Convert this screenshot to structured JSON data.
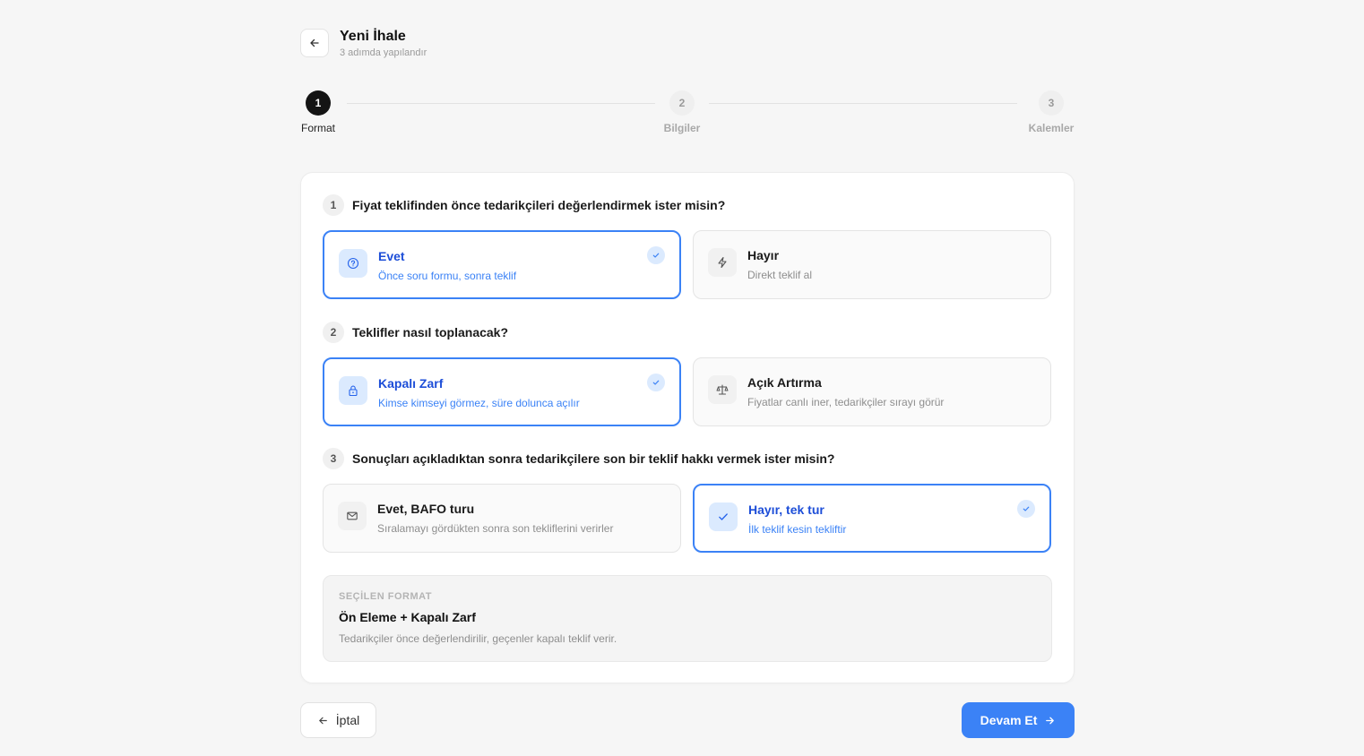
{
  "header": {
    "title": "Yeni İhale",
    "subtitle": "3 adımda yapılandır"
  },
  "steps": [
    {
      "number": "1",
      "label": "Format",
      "active": true
    },
    {
      "number": "2",
      "label": "Bilgiler",
      "active": false
    },
    {
      "number": "3",
      "label": "Kalemler",
      "active": false
    }
  ],
  "questions": [
    {
      "number": "1",
      "text": "Fiyat teklifinden önce tedarikçileri değerlendirmek ister misin?",
      "options": [
        {
          "title": "Evet",
          "desc": "Önce soru formu, sonra teklif",
          "icon": "question-circle-icon",
          "selected": true
        },
        {
          "title": "Hayır",
          "desc": "Direkt teklif al",
          "icon": "lightning-icon",
          "selected": false
        }
      ]
    },
    {
      "number": "2",
      "text": "Teklifler nasıl toplanacak?",
      "options": [
        {
          "title": "Kapalı Zarf",
          "desc": "Kimse kimseyi görmez, süre dolunca açılır",
          "icon": "lock-icon",
          "selected": true
        },
        {
          "title": "Açık Artırma",
          "desc": "Fiyatlar canlı iner, tedarikçiler sırayı görür",
          "icon": "scale-icon",
          "selected": false
        }
      ]
    },
    {
      "number": "3",
      "text": "Sonuçları açıkladıktan sonra tedarikçilere son bir teklif hakkı vermek ister misin?",
      "options": [
        {
          "title": "Evet, BAFO turu",
          "desc": "Sıralamayı gördükten sonra son tekliflerini verirler",
          "icon": "envelope-icon",
          "selected": false
        },
        {
          "title": "Hayır, tek tur",
          "desc": "İlk teklif kesin tekliftir",
          "icon": "check-icon",
          "selected": true
        }
      ]
    }
  ],
  "summary": {
    "label": "SEÇİLEN FORMAT",
    "title": "Ön Eleme + Kapalı Zarf",
    "desc": "Tedarikçiler önce değerlendirilir, geçenler kapalı teklif verir."
  },
  "footer": {
    "cancel_label": "İptal",
    "next_label": "Devam Et"
  },
  "colors": {
    "accent": "#3b82f6",
    "accent_light": "#dbeafe",
    "active_step": "#141414"
  }
}
